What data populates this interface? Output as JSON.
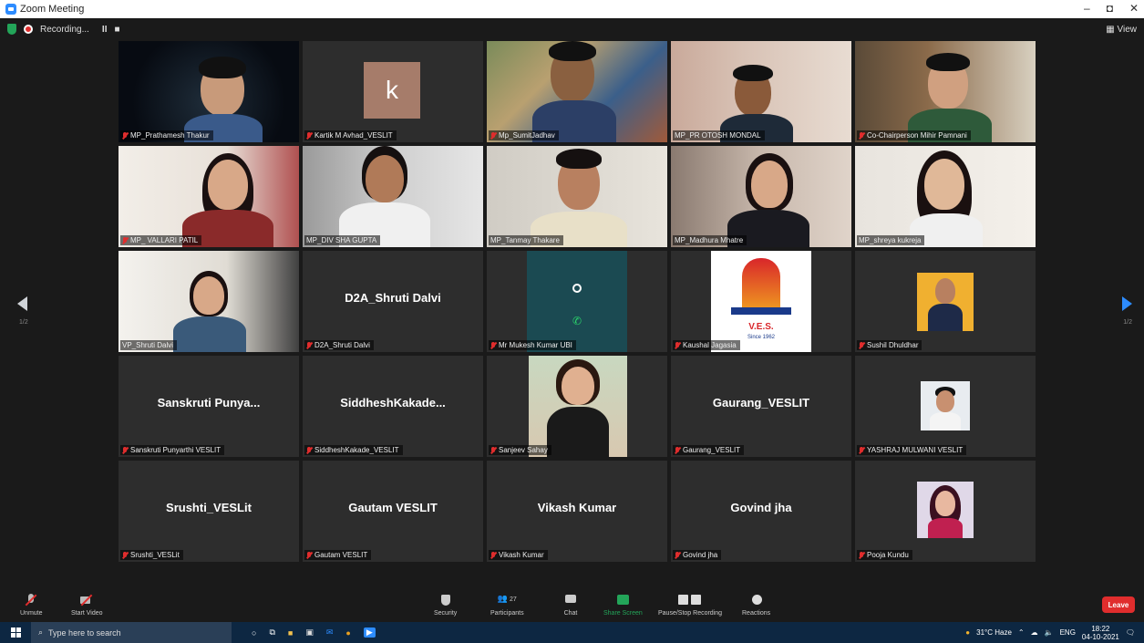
{
  "window": {
    "title": "Zoom Meeting",
    "min": "–",
    "max": "◘",
    "close": "✕"
  },
  "recording": {
    "label": "Recording...",
    "pause": "II",
    "stop": "■"
  },
  "view_button": "View",
  "page_indicator": {
    "left": "1/2",
    "right": "1/2"
  },
  "tiles": [
    {
      "label": "MP_Prathamesh Thakur"
    },
    {
      "label": "Kartik M Avhad_VESLIT",
      "initial": "k"
    },
    {
      "label": "Mp_SumitJadhav"
    },
    {
      "label": "MP_PR OTOSH MONDAL"
    },
    {
      "label": "Co-Chairperson Mihir Pamnani"
    },
    {
      "label": "MP_ VALLARI PATIL"
    },
    {
      "label": "MP_DIV SHA GUPTA"
    },
    {
      "label": "MP_Tanmay Thakare"
    },
    {
      "label": "MP_Madhura Mhatre"
    },
    {
      "label": "MP_shreya kukreja"
    },
    {
      "label": "VP_Shruti Dalvi"
    },
    {
      "label": "D2A_Shruti Dalvi",
      "name": "D2A_Shruti Dalvi"
    },
    {
      "label": "Mr Mukesh Kumar UBI"
    },
    {
      "label": "Kaushal Jagasia",
      "logo_text": "V.E.S.",
      "logo_sub": "Since 1962"
    },
    {
      "label": "Sushil Dhuldhar"
    },
    {
      "label": "Sanskruti Punyarthi VESLIT",
      "name": "Sanskruti  Punya..."
    },
    {
      "label": "SiddheshKakade_VESLIT",
      "name": "SiddheshKakade..."
    },
    {
      "label": "Sanjeev Sahay"
    },
    {
      "label": "Gaurang_VESLIT",
      "name": "Gaurang_VESLIT"
    },
    {
      "label": "YASHRAJ MULWANI VESLIT"
    },
    {
      "label": "Srushti_VESLit",
      "name": "Srushti_VESLit"
    },
    {
      "label": "Gautam VESLIT",
      "name": "Gautam VESLIT"
    },
    {
      "label": "Vikash Kumar",
      "name": "Vikash Kumar"
    },
    {
      "label": "Govind jha",
      "name": "Govind jha"
    },
    {
      "label": "Pooja Kundu"
    }
  ],
  "toolbar": {
    "unmute": "Unmute",
    "start_video": "Start Video",
    "security": "Security",
    "participants": "Participants",
    "participants_count": "27",
    "chat": "Chat",
    "share_screen": "Share Screen",
    "recording": "Pause/Stop Recording",
    "reactions": "Reactions",
    "leave": "Leave"
  },
  "taskbar": {
    "search_placeholder": "Type here to search",
    "weather": "31°C  Haze",
    "lang": "ENG",
    "time": "18:22",
    "date": "04-10-2021"
  },
  "colors": {
    "accent": "#2d8cff",
    "leave": "#e02d2d",
    "active_speaker": "#c9e14d",
    "share": "#23a559"
  }
}
